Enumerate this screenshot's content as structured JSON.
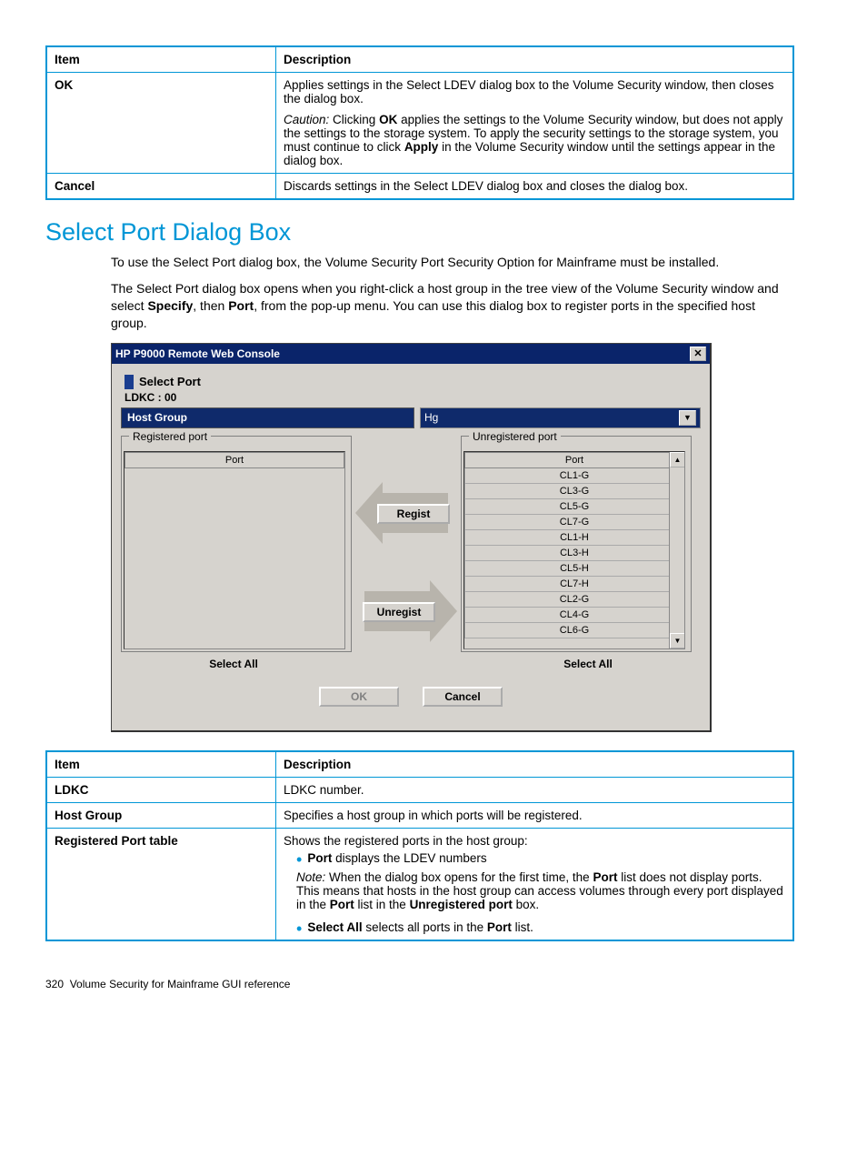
{
  "table1": {
    "headers": {
      "item": "Item",
      "desc": "Description"
    },
    "rows": [
      {
        "item": "OK",
        "desc_p1": "Applies settings in the Select LDEV dialog box to the Volume Security window, then closes the dialog box.",
        "caution_label": "Caution:",
        "caution_1": " Clicking ",
        "caution_bold1": "OK",
        "caution_2": " applies the settings to the Volume Security window, but does not apply the settings to the storage system. To apply the security settings to the storage system, you must continue to click ",
        "caution_bold2": "Apply",
        "caution_3": " in the Volume Security window until the settings appear in the dialog box."
      },
      {
        "item": "Cancel",
        "desc_p1": "Discards settings in the Select LDEV dialog box and closes the dialog box."
      }
    ]
  },
  "section_title": "Select Port Dialog Box",
  "para1": "To use the Select Port dialog box, the Volume Security Port Security Option for Mainframe must be installed.",
  "para2_a": "The Select Port dialog box opens when you right-click a host group in the tree view of the Volume Security window and select ",
  "para2_b1": "Specify",
  "para2_mid": ", then ",
  "para2_b2": "Port",
  "para2_c": ", from the pop-up menu. You can use this dialog box to register ports in the specified host group.",
  "dialog": {
    "title": "HP P9000 Remote Web Console",
    "select_port": "Select Port",
    "ldkc": "LDKC : 00",
    "host_group_label": "Host Group",
    "host_group_value": "Hg",
    "registered_legend": "Registered port",
    "unregistered_legend": "Unregistered port",
    "port_header": "Port",
    "regist_btn": "Regist",
    "unregist_btn": "Unregist",
    "select_all": "Select All",
    "ok": "OK",
    "cancel": "Cancel",
    "unreg_ports": [
      "CL1-G",
      "CL3-G",
      "CL5-G",
      "CL7-G",
      "CL1-H",
      "CL3-H",
      "CL5-H",
      "CL7-H",
      "CL2-G",
      "CL4-G",
      "CL6-G"
    ]
  },
  "table2": {
    "headers": {
      "item": "Item",
      "desc": "Description"
    },
    "rows": {
      "ldkc": {
        "item": "LDKC",
        "desc": "LDKC number."
      },
      "hg": {
        "item": "Host Group",
        "desc": "Specifies a host group in which ports will be registered."
      },
      "rpt": {
        "item": "Registered Port table",
        "line1": "Shows the registered ports in the host group:",
        "bullet1_b": "Port",
        "bullet1_t": " displays the LDEV numbers",
        "note_label": "Note:",
        "note_1": " When the dialog box opens for the first time, the ",
        "note_b1": "Port",
        "note_2": "  list does not display ports. This means that hosts in the host group can access volumes through every port displayed in the ",
        "note_b2": "Port",
        "note_3": "  list in the ",
        "note_b3": "Unregistered port",
        "note_4": " box.",
        "bullet2_b": "Select All",
        "bullet2_t1": " selects all ports in the ",
        "bullet2_b2": "Port",
        "bullet2_t2": "  list."
      }
    }
  },
  "footer": {
    "page": "320",
    "text": "Volume Security for Mainframe GUI reference"
  }
}
